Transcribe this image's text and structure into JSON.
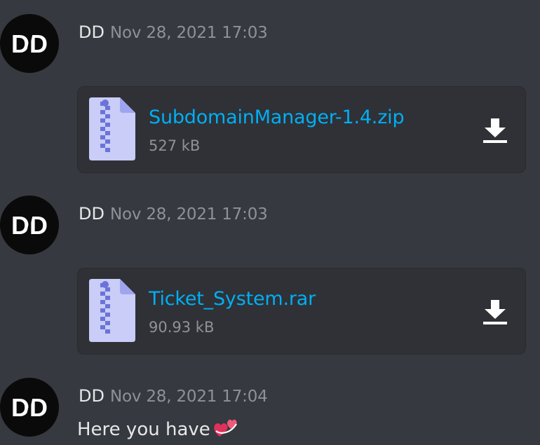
{
  "messages": [
    {
      "username": "DD",
      "timestamp": "Nov 28, 2021 17:03",
      "avatar_text": "DD",
      "attachment": {
        "file_name": "SubdomainManager-1.4.zip",
        "file_size": "527 kB",
        "icon": "zip-file-icon",
        "action_icon": "download-icon"
      }
    },
    {
      "username": "DD",
      "timestamp": "Nov 28, 2021 17:03",
      "avatar_text": "DD",
      "attachment": {
        "file_name": "Ticket_System.rar",
        "file_size": "90.93 kB",
        "icon": "zip-file-icon",
        "action_icon": "download-icon"
      }
    },
    {
      "username": "DD",
      "timestamp": "Nov 28, 2021 17:04",
      "avatar_text": "DD",
      "text": "Here you have",
      "emoji": "revolving-hearts-emoji"
    }
  ],
  "colors": {
    "background": "#36393f",
    "attachment_bg": "#2f3136",
    "link": "#00aff4",
    "muted": "#8e9297",
    "file_icon": "#c9cdf7",
    "zipper": "#6a74d8",
    "emoji_heart": "#e0315a"
  }
}
